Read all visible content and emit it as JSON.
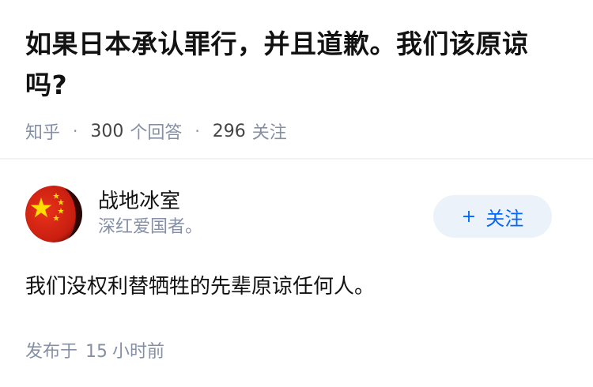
{
  "question": {
    "title": "如果日本承认罪行，并且道歉。我们该原谅吗?",
    "source": "知乎",
    "separator": "·",
    "answer_count": "300",
    "answer_label": "个回答",
    "follower_count": "296",
    "follower_label": "关注"
  },
  "answer": {
    "author": {
      "name": "战地冰室",
      "bio": "深红爱国者。",
      "avatar_icon": "china-flag-avatar-icon"
    },
    "follow_button": {
      "plus": "+",
      "label": "关注"
    },
    "content": "我们没权利替牺牲的先辈原谅任何人。",
    "time_prefix": "发布于",
    "time_value": "15",
    "time_unit": "小时前"
  },
  "colors": {
    "primary_text": "#121212",
    "secondary_text": "#8590a6",
    "follow_button_bg": "#ebf2fa",
    "follow_button_text": "#0066ff",
    "flag_red": "#de2910",
    "flag_yellow": "#ffde00"
  }
}
